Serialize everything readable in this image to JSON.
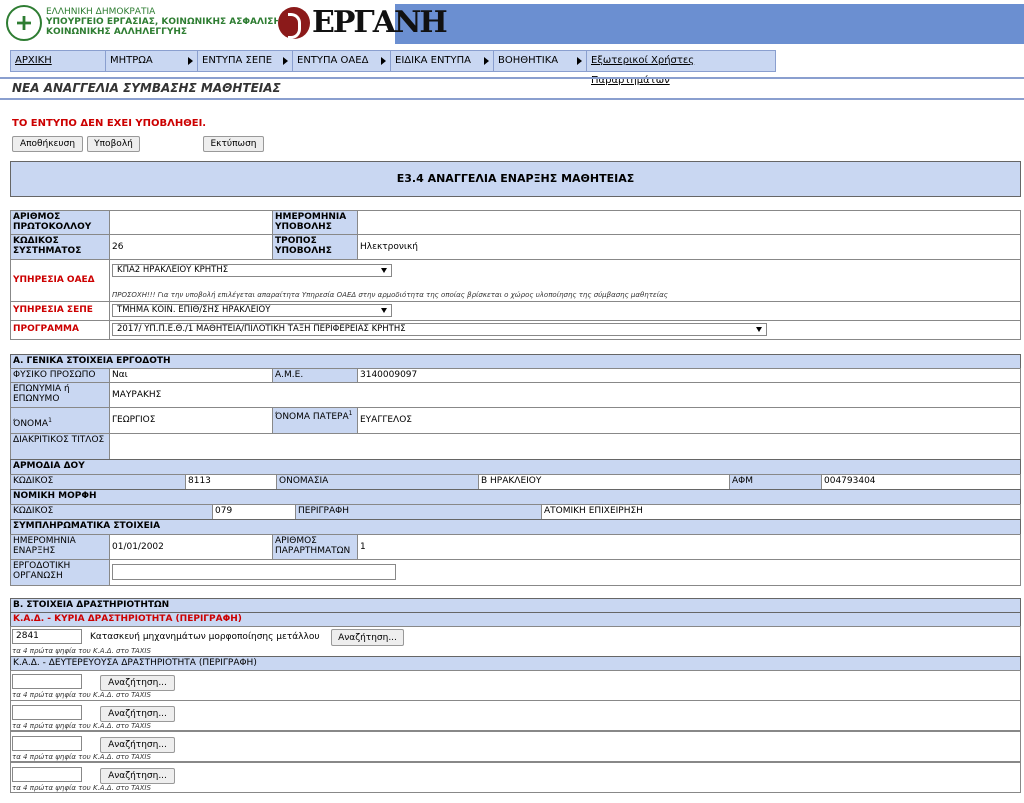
{
  "header": {
    "ministry_line1": "ΕΛΛΗΝΙΚΗ ΔΗΜΟΚΡΑΤΙΑ",
    "ministry_line2": "ΥΠΟΥΡΓΕΙΟ ΕΡΓΑΣΙΑΣ, ΚΟΙΝΩΝΙΚΗΣ ΑΣΦΑΛΙΣΗΣ &",
    "ministry_line3": "ΚΟΙΝΩΝΙΚΗΣ ΑΛΛΗΛΕΓΓΥΗΣ",
    "app_logo_text": "ΕΡΓΑΝΗ"
  },
  "menu": {
    "items": [
      {
        "label": "ΑΡΧΙΚΗ"
      },
      {
        "label": "ΜΗΤΡΩΑ"
      },
      {
        "label": "ΕΝΤΥΠΑ ΣΕΠΕ"
      },
      {
        "label": "ΕΝΤΥΠΑ ΟΑΕΔ"
      },
      {
        "label": "ΕΙΔΙΚΑ ΕΝΤΥΠΑ"
      },
      {
        "label": "ΒΟΗΘΗΤΙΚΑ"
      },
      {
        "label": "Εξωτερικοί Χρήστες Παραρτημάτων"
      }
    ]
  },
  "page": {
    "title": "ΝΕΑ ΑΝΑΓΓΕΛΙΑ ΣΥΜΒΑΣΗΣ ΜΑΘΗΤΕΙΑΣ",
    "status": "ΤΟ ΕΝΤΥΠΟ ΔΕΝ ΕΧΕΙ ΥΠΟΒΛΗΘΕΙ.",
    "save_label": "Αποθήκευση",
    "submit_label": "Υποβολή",
    "print_label": "Εκτύπωση",
    "form_title": "Ε3.4 ΑΝΑΓΓΕΛΙΑ ΕΝΑΡΞΗΣ ΜΑΘΗΤΕΙΑΣ"
  },
  "top": {
    "protocol_label": "ΑΡΙΘΜΟΣ ΠΡΩΤΟΚΟΛΛΟΥ",
    "protocol_value": "",
    "submit_date_label": "ΗΜΕΡΟΜΗΝΙΑ ΥΠΟΒΟΛΗΣ",
    "submit_date_value": "",
    "system_code_label": "ΚΩΔΙΚΟΣ ΣΥΣΤΗΜΑΤΟΣ",
    "system_code_value": "26",
    "submit_mode_label": "ΤΡΟΠΟΣ ΥΠΟΒΟΛΗΣ",
    "submit_mode_value": "Ηλεκτρονική",
    "oaed_label": "ΥΠΗΡΕΣΙΑ ΟΑΕΔ",
    "oaed_value": "ΚΠΑ2 ΗΡΑΚΛΕΙΟΥ ΚΡΗΤΗΣ",
    "oaed_note": "ΠΡΟΣΟΧΗ!!! Για την υποβολή επιλέγεται απαραίτητα Υπηρεσία ΟΑΕΔ στην αρμοδιότητα της οποίας βρίσκεται ο χώρος υλοποίησης της σύμβασης μαθητείας",
    "sepe_label": "ΥΠΗΡΕΣΙΑ ΣΕΠΕ",
    "sepe_value": "ΤΜΗΜΑ ΚΟΙΝ. ΕΠΙΘ/ΣΗΣ ΗΡΑΚΛΕΙΟΥ",
    "program_label": "ΠΡΟΓΡΑΜΜΑ",
    "program_value": "2017/ ΥΠ.Π.Ε.Θ./1 ΜΑΘΗΤΕΙΑ/ΠΙΛΟΤΙΚΗ ΤΑΞΗ ΠΕΡΙΦΕΡΕΙΑΣ ΚΡΗΤΗΣ"
  },
  "employer": {
    "section_title": "Α. ΓΕΝΙΚΑ ΣΤΟΙΧΕΙΑ ΕΡΓΟΔΟΤΗ",
    "natural_person_label": "ΦΥΣΙΚΟ ΠΡΟΣΩΠΟ",
    "natural_person_value": "Ναι",
    "ame_label": "Α.Μ.Ε.",
    "ame_value": "3140009097",
    "name_label": "ΕΠΩΝΥΜΙΑ ή ΕΠΩΝΥΜΟ",
    "name_value": "ΜΑΥΡΑΚΗΣ",
    "first_name_label": "ΌΝΟΜΑ",
    "first_name_sup": "1",
    "first_name_value": "ΓΕΩΡΓΙΟΣ",
    "father_name_label": "ΌΝΟΜΑ ΠΑΤΕΡΑ",
    "father_name_sup": "1",
    "father_name_value": "ΕΥΑΓΓΕΛΟΣ",
    "distinctive_title_label": "ΔΙΑΚΡΙΤΙΚΟΣ ΤΙΤΛΟΣ",
    "distinctive_title_value": "",
    "doy_section": "ΑΡΜΟΔΙΑ ΔΟΥ",
    "doy_code_label": "ΚΩΔΙΚΟΣ",
    "doy_code_value": "8113",
    "doy_name_label": "ΟΝΟΜΑΣΙΑ",
    "doy_name_value": "Β ΗΡΑΚΛΕΙΟΥ",
    "afm_label": "ΑΦΜ",
    "afm_value": "004793404",
    "legal_section": "ΝΟΜΙΚΗ ΜΟΡΦΗ",
    "legal_code_label": "ΚΩΔΙΚΟΣ",
    "legal_code_value": "079",
    "legal_desc_label": "ΠΕΡΙΓΡΑΦΗ",
    "legal_desc_value": "ΑΤΟΜΙΚΗ ΕΠΙΧΕΙΡΗΣΗ",
    "supp_section": "ΣΥΜΠΛΗΡΩΜΑΤΙΚΑ ΣΤΟΙΧΕΙΑ",
    "start_date_label": "ΗΜΕΡΟΜΗΝΙΑ ΕΝΑΡΞΗΣ",
    "start_date_value": "01/01/2002",
    "branches_label": "ΑΡΙΘΜΟΣ ΠΑΡΑΡΤΗΜΑΤΩΝ",
    "branches_value": "1",
    "org_label": "ΕΡΓΟΔΟΤΙΚΗ ΟΡΓΑΝΩΣΗ",
    "org_value": ""
  },
  "activities": {
    "section_title": "Β. ΣΤΟΙΧΕΙΑ ΔΡΑΣΤΗΡΙΟΤΗΤΩΝ",
    "main_label": "Κ.Α.Δ. - ΚΥΡΙΑ ΔΡΑΣΤΗΡΙΟΤΗΤΑ (ΠΕΡΙΓΡΑΦΗ)",
    "main_code": "2841",
    "main_desc": "Κατασκευή μηχανημάτων μορφοποίησης μετάλλου",
    "search_label": "Αναζήτηση...",
    "hint": "τα 4 πρώτα ψηφία του Κ.Α.Δ. στο TAXIS",
    "secondary_label": "Κ.Α.Δ. - ΔΕΥΤΕΡΕΥΟΥΣΑ ΔΡΑΣΤΗΡΙΟΤΗΤΑ (ΠΕΡΙΓΡΑΦΗ)",
    "secondary_rows": [
      {
        "code": ""
      },
      {
        "code": ""
      },
      {
        "code": ""
      },
      {
        "code": ""
      }
    ]
  }
}
